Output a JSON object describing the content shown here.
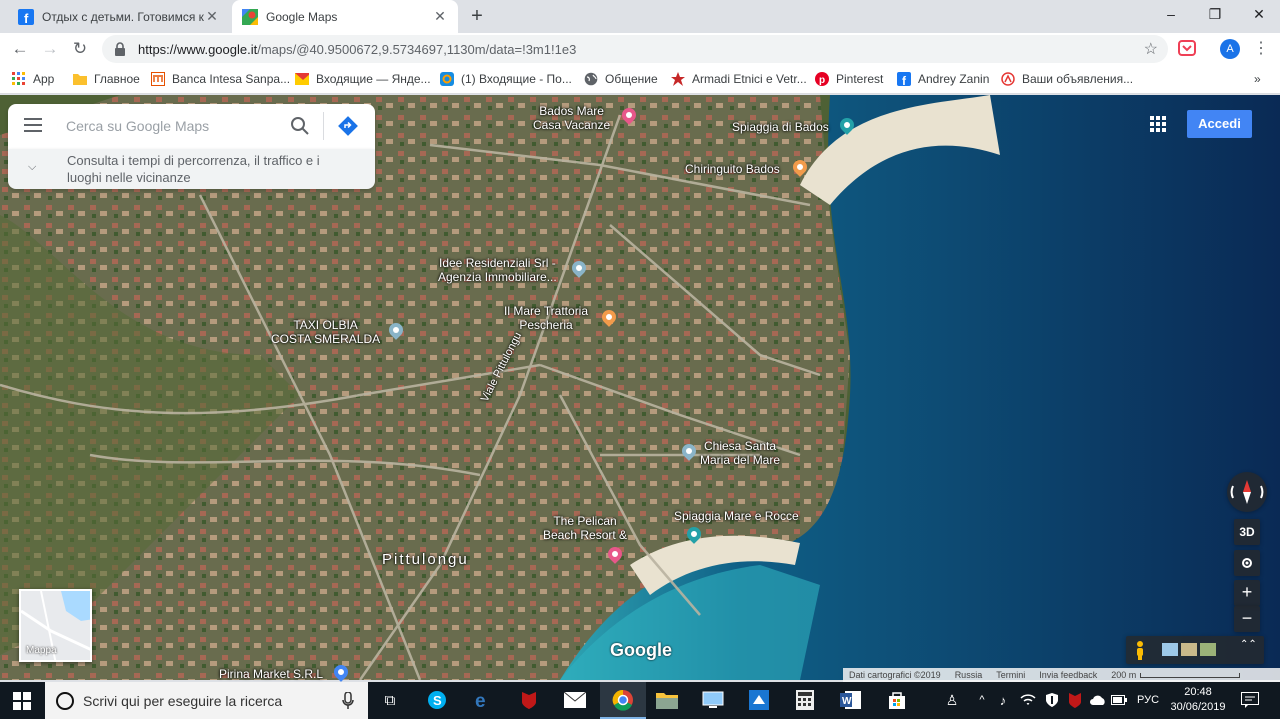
{
  "browser": {
    "tabs": [
      {
        "title": "Отдых с детьми. Готовимся к пс",
        "active": false,
        "icon": "facebook-icon"
      },
      {
        "title": "Google Maps",
        "active": true,
        "icon": "google-maps-icon"
      }
    ],
    "new_tab": "+",
    "window_controls": {
      "minimize": "–",
      "maximize": "❐",
      "close": "✕"
    },
    "url_host": "https://www.google.it",
    "url_path": "/maps/@40.9500672,9.5734697,1130m/data=!3m1!1e3",
    "account_initial": "A",
    "bookmarks": [
      {
        "label": "App",
        "icon": "apps-grid-icon"
      },
      {
        "label": "Главное",
        "icon": "folder-icon"
      },
      {
        "label": "Banca Intesa Sanpa...",
        "icon": "bank-icon"
      },
      {
        "label": "Входящие — Янде...",
        "icon": "mail-icon"
      },
      {
        "label": "(1) Входящие - По...",
        "icon": "mail-ru-icon"
      },
      {
        "label": "Общение",
        "icon": "globe-icon"
      },
      {
        "label": "Armadi Etnici e Vetr...",
        "icon": "star-logo-icon"
      },
      {
        "label": "Pinterest",
        "icon": "pinterest-icon"
      },
      {
        "label": "Andrey Zanin",
        "icon": "facebook-icon"
      },
      {
        "label": "Ваши объявления...",
        "icon": "avito-icon"
      }
    ],
    "bookmarks_more": "»"
  },
  "maps": {
    "search_placeholder": "Cerca su Google Maps",
    "explore_text": "Consulta i tempi di percorrenza, il traffico e i luoghi nelle vicinanze",
    "sign_in": "Accedi",
    "labels": [
      {
        "text": "Bados Mare\nCasa Vacanze",
        "pin": "#e8578a"
      },
      {
        "text": "Spiaggia di Bados",
        "pin": "#23a1a8"
      },
      {
        "text": "Chiringuito Bados",
        "pin": "#f29b4b"
      },
      {
        "text": "Idee Residenziali Srl -\nAgenzia Immobiliare...",
        "pin": "#8ab4c8"
      },
      {
        "text": "Il Mare Trattoria\nPescheria",
        "pin": "#f29b4b"
      },
      {
        "text": "TAXI OLBIA\nCOSTA SMERALDA",
        "pin": "#8ab4c8"
      },
      {
        "text": "Viale Pittulongu",
        "pin": ""
      },
      {
        "text": "Chiesa Santa\nMaria del Mare",
        "pin": "#8ab4c8"
      },
      {
        "text": "The Pelican\nBeach Resort &",
        "pin": "#e8578a"
      },
      {
        "text": "Spiaggia Mare e Rocce",
        "pin": "#23a1a8"
      },
      {
        "text": "Pittulongu",
        "pin": ""
      },
      {
        "text": "Pirina Market S.R.L",
        "pin": "#4285f4"
      }
    ],
    "minimap_label": "Mappa",
    "google_logo": "Google",
    "controls": {
      "three_d": "3D",
      "zoom_in": "+",
      "zoom_out": "−",
      "expand": "⌃⌃"
    },
    "attribution": {
      "data": "Dati cartografici ©2019",
      "region": "Russia",
      "terms": "Termini",
      "feedback": "Invia feedback",
      "scale": "200 m"
    }
  },
  "taskbar": {
    "search_text": "Scrivi qui per eseguire la ricerca",
    "language": "РУС",
    "time": "20:48",
    "date": "30/06/2019"
  }
}
